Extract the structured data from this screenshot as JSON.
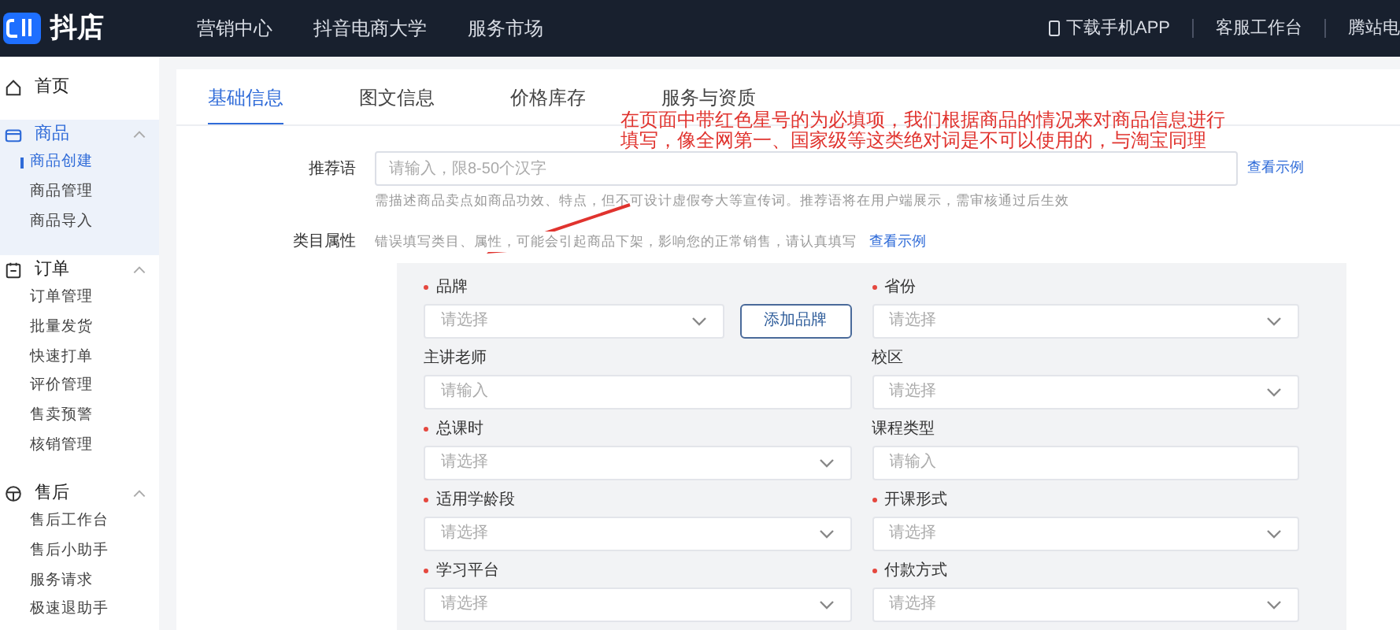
{
  "top_bar": {
    "logo": "抖店",
    "nav": [
      "营销中心",
      "抖音电商大学",
      "服务市场"
    ],
    "right": [
      {
        "kind": "phone",
        "label": "下载手机APP"
      },
      {
        "kind": "text",
        "label": "客服工作台"
      },
      {
        "kind": "text",
        "label": "腾站电"
      }
    ]
  },
  "sidebar": [
    {
      "title": "首页"
    },
    {
      "title": "商品",
      "expanded": true,
      "active": true,
      "items": [
        {
          "label": "商品创建",
          "selected": true
        },
        {
          "label": "商品管理",
          "selected": false
        },
        {
          "label": "商品导入",
          "selected": false
        }
      ]
    },
    {
      "title": "订单",
      "expanded": true,
      "active": false,
      "items": [
        {
          "label": "订单管理",
          "selected": false
        },
        {
          "label": "批量发货",
          "selected": false
        },
        {
          "label": "快速打单",
          "selected": false
        },
        {
          "label": "评价管理",
          "selected": false
        },
        {
          "label": "售卖预警",
          "selected": false
        },
        {
          "label": "核销管理",
          "selected": false
        }
      ]
    },
    {
      "title": "售后",
      "expanded": true,
      "active": false,
      "items": [
        {
          "label": "售后工作台",
          "selected": false
        },
        {
          "label": "售后小助手",
          "selected": false
        },
        {
          "label": "服务请求",
          "selected": false
        },
        {
          "label": "极速退助手",
          "selected": false
        }
      ]
    }
  ],
  "tabs": [
    {
      "label": "基础信息",
      "selected": true
    },
    {
      "label": "图文信息",
      "selected": false
    },
    {
      "label": "价格库存",
      "selected": false
    },
    {
      "label": "服务与资质",
      "selected": false
    }
  ],
  "recommend": {
    "label": "推荐语",
    "placeholder": "请输入，限8-50个汉字",
    "hint": "需描述商品卖点如商品功效、特点，但不可设计虚假夸大等宣传词。推荐语将在用户端展示，需审核通过后生效",
    "link": "查看示例"
  },
  "category": {
    "label": "类目属性",
    "hint": "错误填写类目、属性，可能会引起商品下架，影响您的正常销售，请认真填写",
    "link": "查看示例"
  },
  "fields": [
    {
      "label": "品牌",
      "required": true,
      "kind": "select",
      "placeholder": "请选择",
      "button": "添加品牌"
    },
    {
      "label": "省份",
      "required": true,
      "kind": "select",
      "placeholder": "请选择"
    },
    {
      "label": "主讲老师",
      "required": false,
      "kind": "input",
      "placeholder": "请输入"
    },
    {
      "label": "校区",
      "required": false,
      "kind": "select",
      "placeholder": "请选择"
    },
    {
      "label": "总课时",
      "required": true,
      "kind": "select",
      "placeholder": "请选择"
    },
    {
      "label": "课程类型",
      "required": false,
      "kind": "input",
      "placeholder": "请输入"
    },
    {
      "label": "适用学龄段",
      "required": true,
      "kind": "select",
      "placeholder": "请选择"
    },
    {
      "label": "开课形式",
      "required": true,
      "kind": "select",
      "placeholder": "请选择"
    },
    {
      "label": "学习平台",
      "required": true,
      "kind": "select",
      "placeholder": "请选择"
    },
    {
      "label": "付款方式",
      "required": true,
      "kind": "select",
      "placeholder": "请选择"
    }
  ],
  "annotation": {
    "text": "在页面中带红色星号的为必填项，我们根据商品的情况来对商品信息进行填写，像全网第一、国家级等这类绝对词是不可以使用的，与淘宝同理"
  }
}
